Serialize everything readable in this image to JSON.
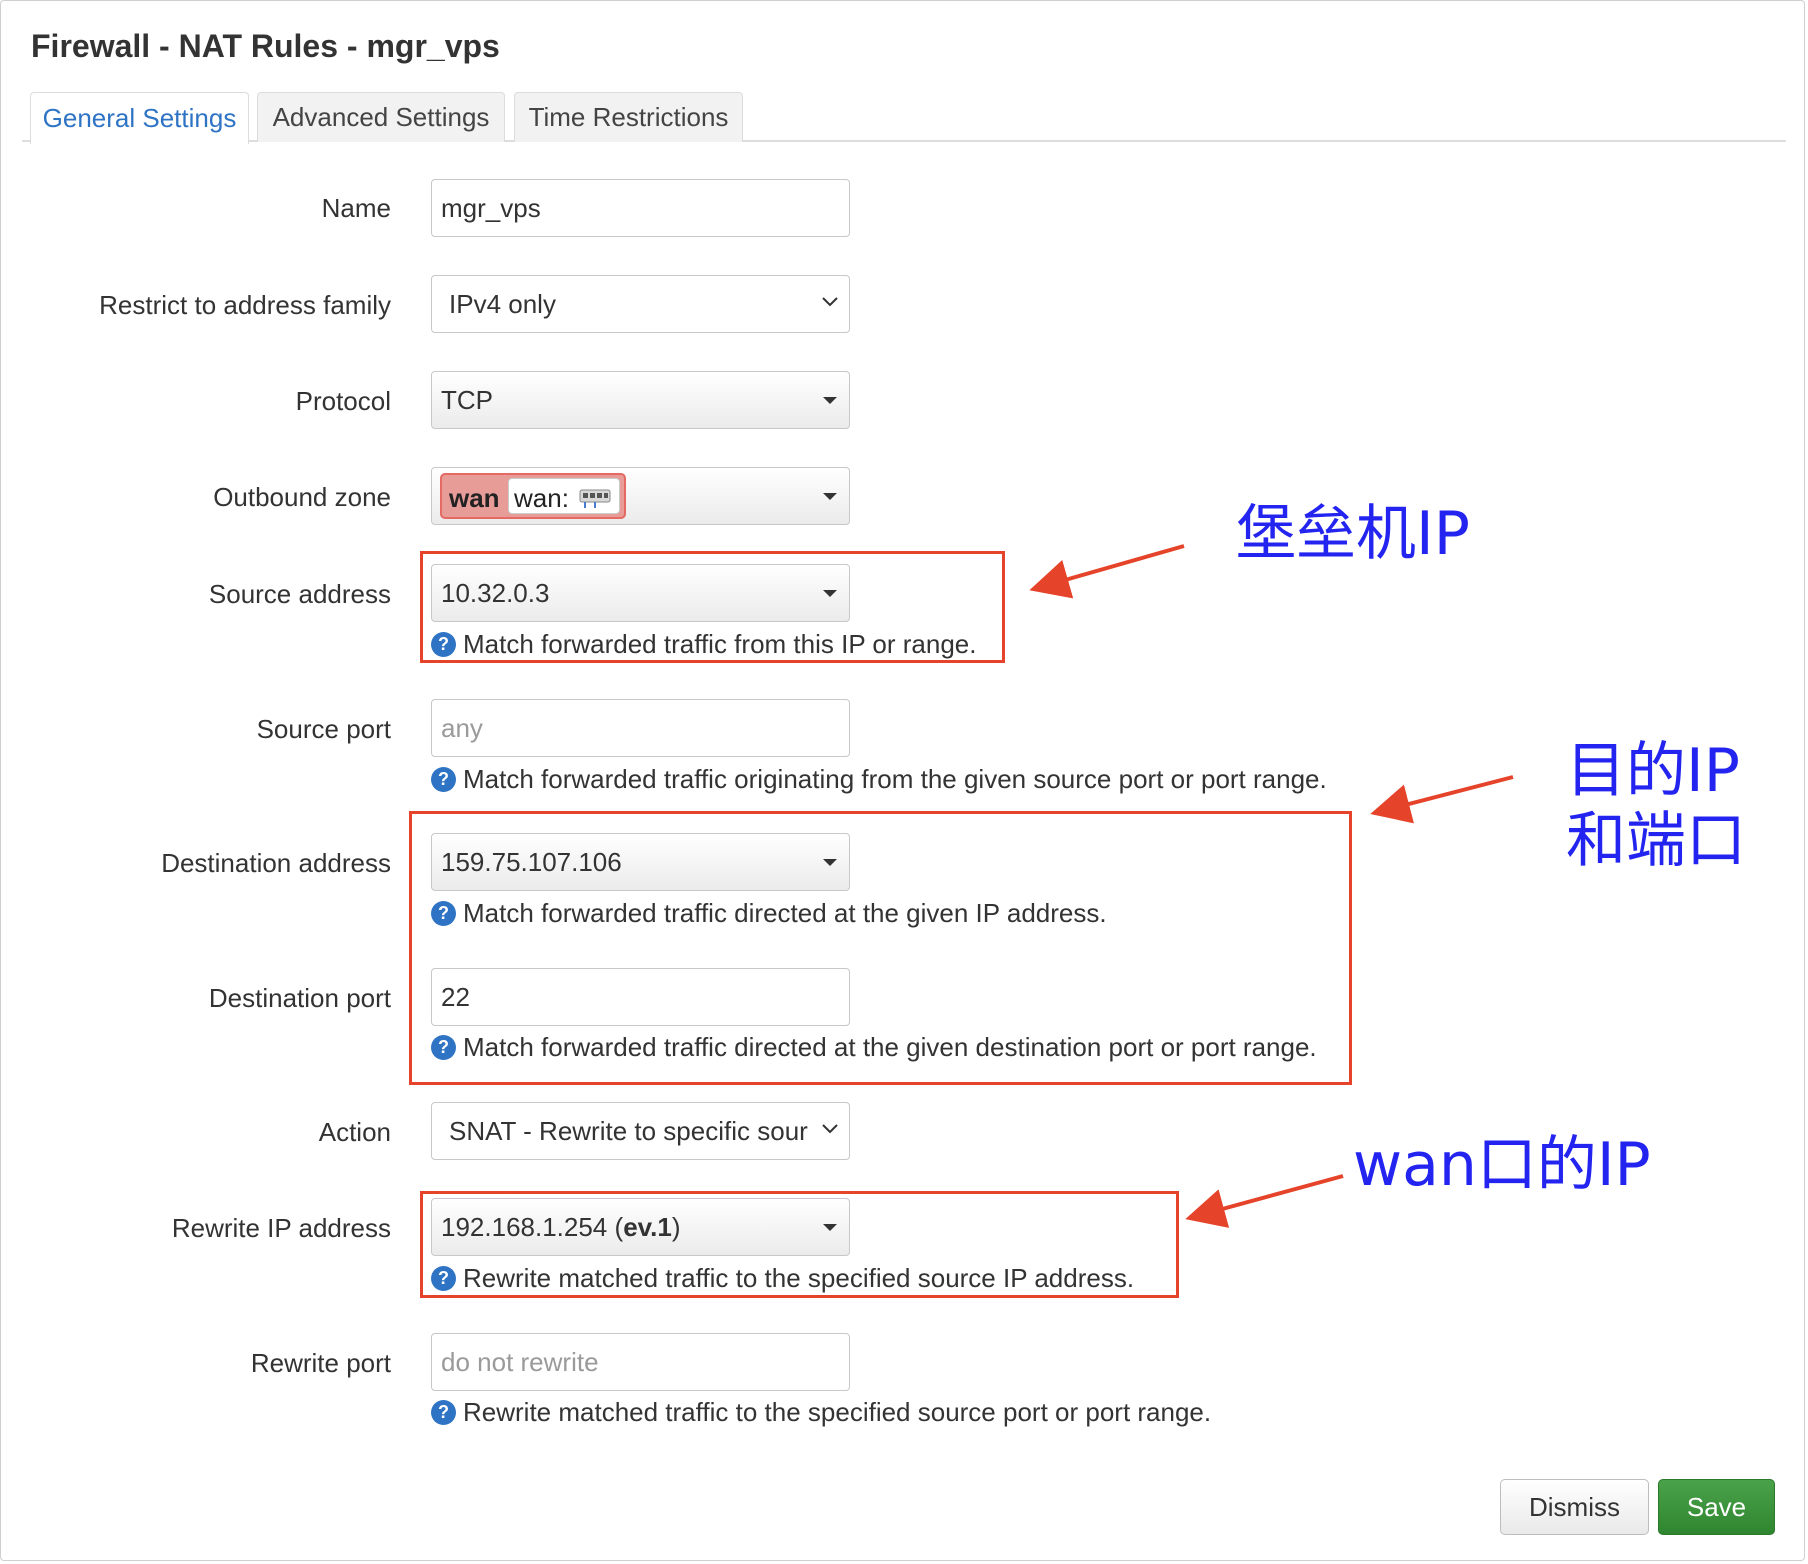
{
  "dialog": {
    "title": "Firewall - NAT Rules - mgr_vps"
  },
  "tabs": [
    {
      "label": "General Settings",
      "active": true
    },
    {
      "label": "Advanced Settings",
      "active": false
    },
    {
      "label": "Time Restrictions",
      "active": false
    }
  ],
  "fields": {
    "name": {
      "label": "Name",
      "value": "mgr_vps"
    },
    "family": {
      "label": "Restrict to address family",
      "value": "IPv4 only"
    },
    "protocol": {
      "label": "Protocol",
      "value": "TCP"
    },
    "zone": {
      "label": "Outbound zone",
      "zone_name": "wan",
      "iface": "wan:"
    },
    "src_addr": {
      "label": "Source address",
      "value": "10.32.0.3",
      "help": "Match forwarded traffic from this IP or range."
    },
    "src_port": {
      "label": "Source port",
      "placeholder": "any",
      "help": "Match forwarded traffic originating from the given source port or port range."
    },
    "dest_addr": {
      "label": "Destination address",
      "value": "159.75.107.106",
      "help": "Match forwarded traffic directed at the given IP address."
    },
    "dest_port": {
      "label": "Destination port",
      "value": "22",
      "help": "Match forwarded traffic directed at the given destination port or port range."
    },
    "action": {
      "label": "Action",
      "value": "SNAT - Rewrite to specific sour"
    },
    "rewrite_ip": {
      "label": "Rewrite IP address",
      "value": "192.168.1.254",
      "value_suffix": "(",
      "value_device": "ev.1",
      "value_close": ")",
      "help": "Rewrite matched traffic to the specified source IP address."
    },
    "rewrite_port": {
      "label": "Rewrite port",
      "placeholder": "do not rewrite",
      "help": "Rewrite matched traffic to the specified source port or port range."
    }
  },
  "help_icon": {
    "glyph": "?",
    "icon": "question-circle-icon"
  },
  "annotations": {
    "bastion": "堡垒机IP",
    "dest_line1": "目的IP",
    "dest_line2": "和端口",
    "wan": "wan口的IP",
    "color": "#2424f0",
    "box_color": "#e6442a"
  },
  "buttons": {
    "dismiss": "Dismiss",
    "save": "Save"
  }
}
